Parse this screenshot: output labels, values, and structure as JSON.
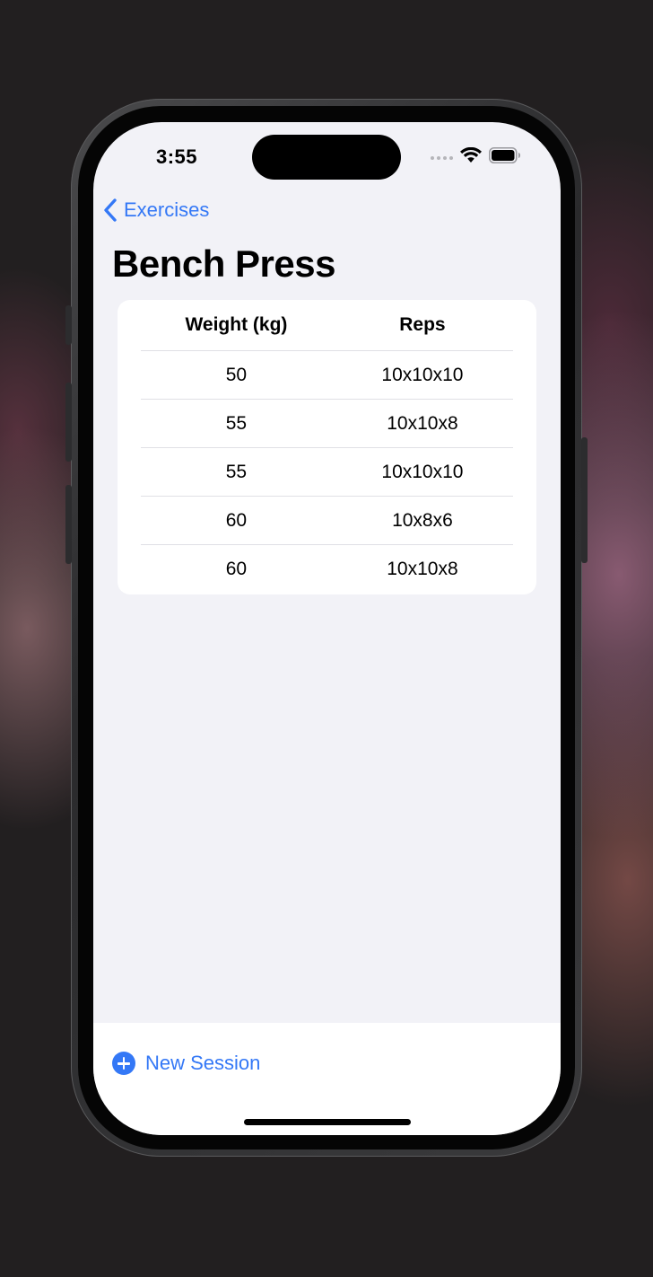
{
  "status_bar": {
    "time": "3:55"
  },
  "nav": {
    "back_label": "Exercises",
    "title": "Bench Press"
  },
  "table": {
    "columns": [
      "Weight (kg)",
      "Reps"
    ],
    "rows": [
      [
        "50",
        "10x10x10"
      ],
      [
        "55",
        "10x10x8"
      ],
      [
        "55",
        "10x10x10"
      ],
      [
        "60",
        "10x8x6"
      ],
      [
        "60",
        "10x10x8"
      ]
    ]
  },
  "toolbar": {
    "new_session_label": "New Session"
  },
  "colors": {
    "accent": "#3478f6",
    "background": "#f2f2f7",
    "card": "#ffffff"
  }
}
